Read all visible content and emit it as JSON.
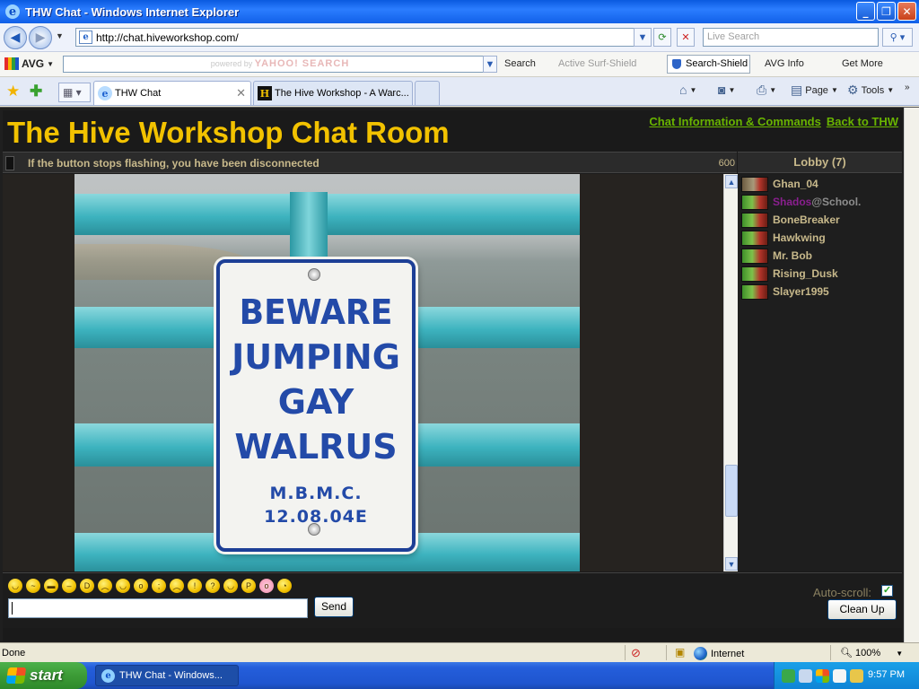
{
  "window": {
    "title": "THW Chat - Windows Internet Explorer",
    "url": "http://chat.hiveworkshop.com/",
    "search_placeholder": "Live Search"
  },
  "avg_toolbar": {
    "brand": "AVG",
    "search_hint": "powered by",
    "search_brand": "YAHOO! SEARCH",
    "search_label": "Search",
    "active_surf_shield": "Active  Surf-Shield",
    "search_shield": "Search-Shield",
    "avg_info": "AVG Info",
    "get_more": "Get More"
  },
  "tabs": [
    {
      "label": "THW Chat"
    },
    {
      "label": "The Hive Workshop - A Warc..."
    }
  ],
  "commands": {
    "page": "Page",
    "tools": "Tools"
  },
  "chat": {
    "title": "The Hive Workshop Chat Room",
    "links": [
      "Chat Information & Commands",
      "Back to THW"
    ],
    "status_message": "If the button stops flashing, you have been disconnected",
    "status_count": "600",
    "sign_lines": [
      "BEWARE",
      "JUMPING",
      "GAY",
      "WALRUS"
    ],
    "sign_footer": "M.B.M.C. 12.08.04E",
    "lobby_title": "Lobby (7)",
    "users": [
      {
        "name": "Ghan_04"
      },
      {
        "name_prefix": "Shados",
        "name_suffix": "@School."
      },
      {
        "name": "BoneBreaker"
      },
      {
        "name": "Hawkwing"
      },
      {
        "name": "Mr. Bob"
      },
      {
        "name": "Rising_Dusk"
      },
      {
        "name": "Slayer1995"
      }
    ],
    "send_label": "Send",
    "autoscroll_label": "Auto-scroll:",
    "cleanup_label": "Clean Up"
  },
  "ie_status": {
    "left": "Done",
    "zone": "Internet",
    "zoom": "100%"
  },
  "taskbar": {
    "start": "start",
    "task_item": "THW Chat - Windows...",
    "clock": "9:57 PM"
  },
  "colors": {
    "title_yellow": "#f2c200",
    "link_green": "#69b400",
    "user_tan": "#c8b98b",
    "user_purple": "#8a1f8f"
  }
}
